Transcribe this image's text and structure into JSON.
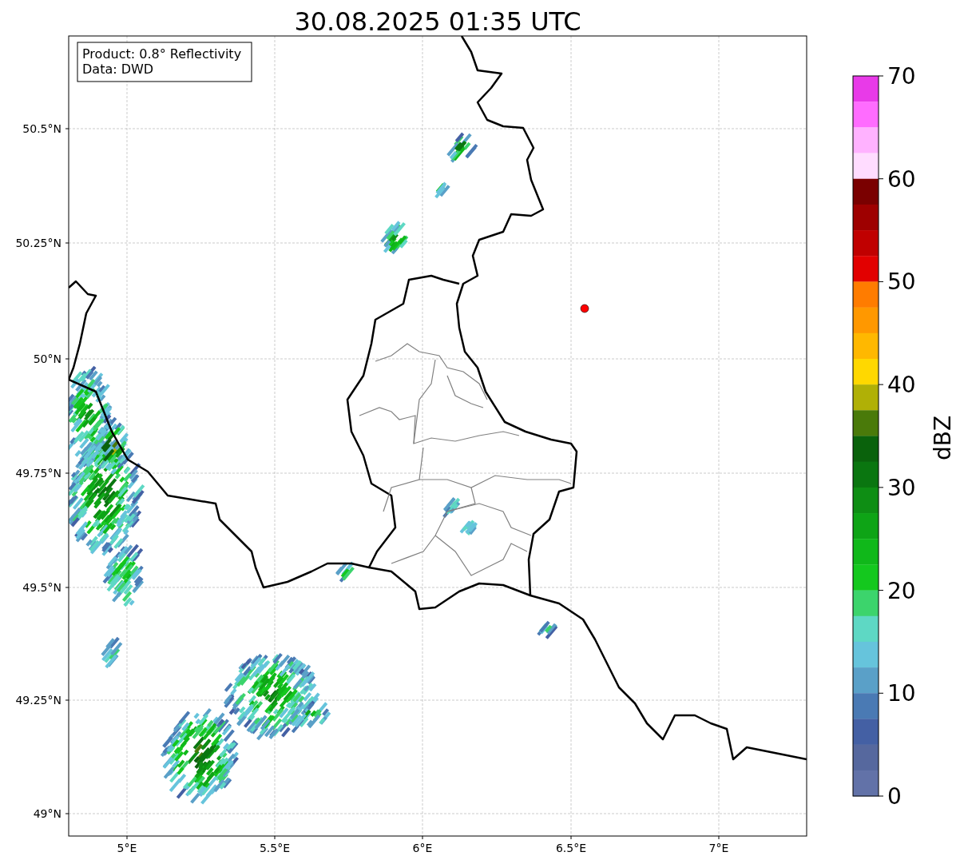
{
  "title": "30.08.2025 01:35 UTC",
  "info_box": [
    "Product: 0.8° Reflectivity",
    "Data: DWD"
  ],
  "map": {
    "x_ticks": [
      "5°E",
      "5.5°E",
      "6°E",
      "6.5°E",
      "7°E"
    ],
    "y_ticks": [
      "50.5°N",
      "50.25°N",
      "50°N",
      "49.75°N",
      "49.5°N",
      "49.25°N",
      "49°N"
    ]
  },
  "colorbar": {
    "label": "dBZ",
    "ticks": [
      "70",
      "60",
      "50",
      "40",
      "30",
      "20",
      "10",
      "0"
    ],
    "bands": [
      {
        "color": "#e83ae8"
      },
      {
        "color": "#ff6cff"
      },
      {
        "color": "#ffb2ff"
      },
      {
        "color": "#ffdcff"
      },
      {
        "color": "#7a0000"
      },
      {
        "color": "#9e0000"
      },
      {
        "color": "#c00000"
      },
      {
        "color": "#e20000"
      },
      {
        "color": "#ff7c00"
      },
      {
        "color": "#ff9800"
      },
      {
        "color": "#ffb800"
      },
      {
        "color": "#ffd800"
      },
      {
        "color": "#b0b006"
      },
      {
        "color": "#4a7a0a"
      },
      {
        "color": "#0a620c"
      },
      {
        "color": "#0a7610"
      },
      {
        "color": "#0e8e14"
      },
      {
        "color": "#0ea416"
      },
      {
        "color": "#10b81a"
      },
      {
        "color": "#14c81e"
      },
      {
        "color": "#3cd46c"
      },
      {
        "color": "#5ed8c4"
      },
      {
        "color": "#66c4dc"
      },
      {
        "color": "#5aa0c8"
      },
      {
        "color": "#4a7ab4"
      },
      {
        "color": "#4460a4"
      },
      {
        "color": "#56689e"
      },
      {
        "color": "#6272a8"
      }
    ]
  }
}
